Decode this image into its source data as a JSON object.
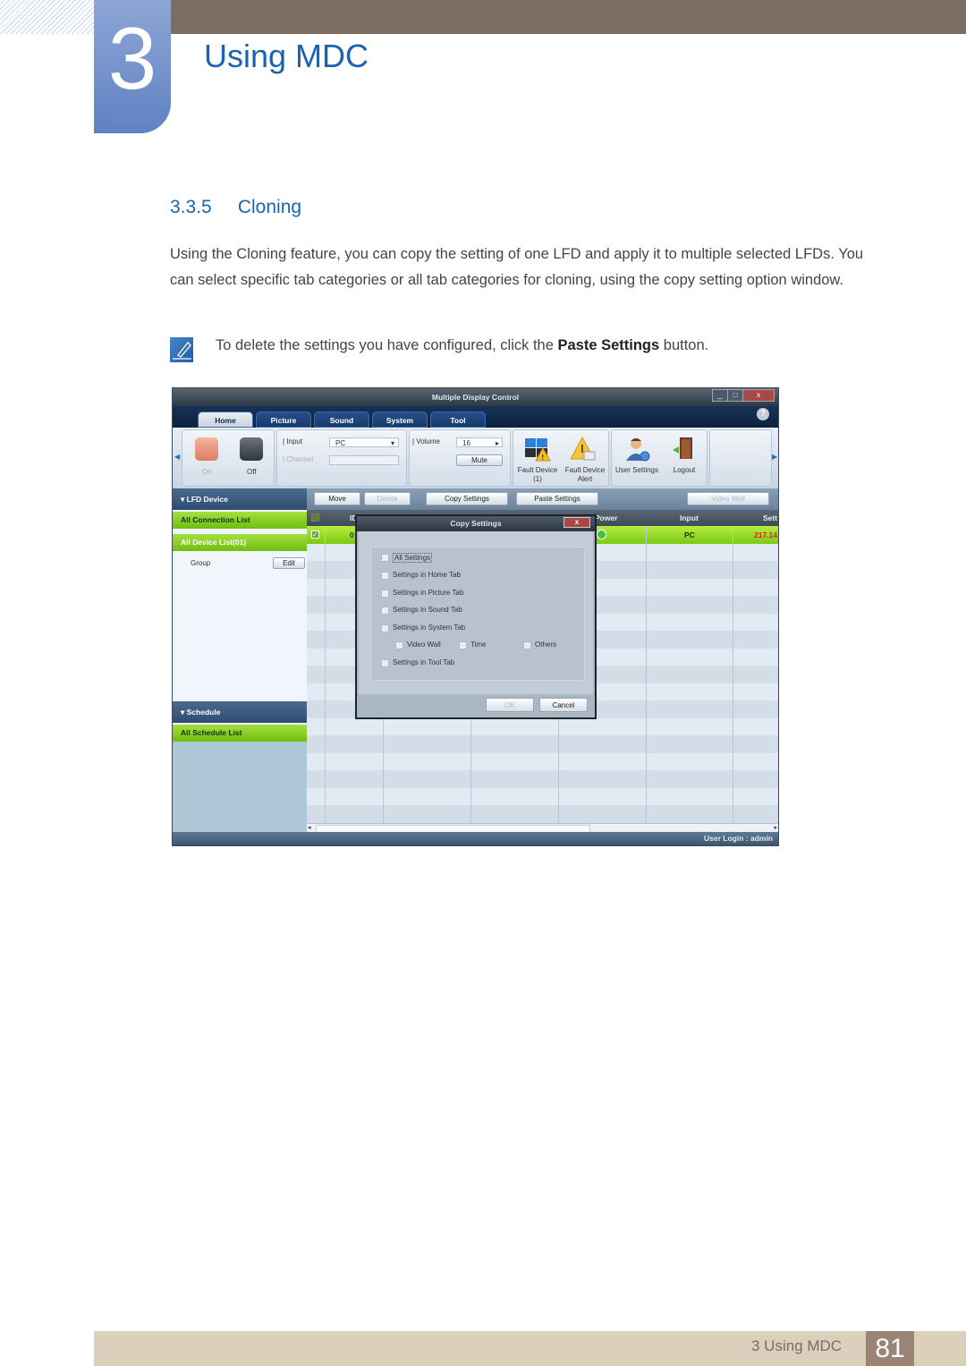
{
  "header": {
    "chapter_number": "3",
    "chapter_title": "Using MDC"
  },
  "section": {
    "number": "3.3.5",
    "title": "Cloning"
  },
  "body": {
    "paragraph": "Using the Cloning feature, you can copy the setting of one LFD and apply it to multiple selected LFDs. You can select specific tab categories or all tab categories for cloning, using the copy setting option window.",
    "note_prefix": "To delete the settings you have configured, click the ",
    "note_bold": "Paste Settings",
    "note_suffix": " button."
  },
  "app": {
    "window_title": "Multiple Display Control",
    "window_buttons": {
      "minimize": "_",
      "maximize": "□",
      "close": "x"
    },
    "help": "?",
    "tabs": [
      {
        "label": "Home",
        "active": true
      },
      {
        "label": "Picture",
        "active": false
      },
      {
        "label": "Sound",
        "active": false
      },
      {
        "label": "System",
        "active": false
      },
      {
        "label": "Tool",
        "active": false
      }
    ],
    "ribbon": {
      "power_on": "On",
      "power_off": "Off",
      "input_label": "Input",
      "input_value": "PC",
      "channel_label": "Channel",
      "channel_value": "",
      "volume_label": "Volume",
      "volume_value": "16",
      "mute_label": "Mute",
      "fault_device_label": "Fault Device",
      "fault_device_count": "(1)",
      "fault_alert_label_1": "Fault Device",
      "fault_alert_label_2": "Alert",
      "user_settings_label": "User Settings",
      "logout_label": "Logout"
    },
    "sidebar": {
      "lfd_device": "LFD Device",
      "all_connection_list": "All Connection List",
      "all_device_list": "All Device List(01)",
      "group_label": "Group",
      "edit_button": "Edit",
      "schedule": "Schedule",
      "all_schedule_list": "All Schedule List"
    },
    "toolbar": {
      "move": "Move",
      "delete": "Delete",
      "copy_settings": "Copy Settings",
      "paste_settings": "Paste Settings",
      "video_wall": "Video Wall"
    },
    "grid": {
      "columns": [
        "ID",
        "Power",
        "Input",
        "Sett"
      ],
      "rows": [
        {
          "checked": true,
          "id": "0",
          "power": "on",
          "input": "PC",
          "setting": "217.14"
        }
      ]
    },
    "dialog": {
      "title": "Copy Settings",
      "close": "x",
      "options": [
        "All Settings",
        "Settings in Home Tab",
        "Settings in Picture Tab",
        "Settings in Sound Tab",
        "Settings in System Tab"
      ],
      "sub_options": [
        "Video Wall",
        "Time",
        "Others"
      ],
      "last_option": "Settings in Tool Tab",
      "ok": "OK",
      "cancel": "Cancel"
    },
    "status": "User Login : admin"
  },
  "footer": {
    "chapter_label": "3 Using MDC",
    "page_number": "81"
  }
}
